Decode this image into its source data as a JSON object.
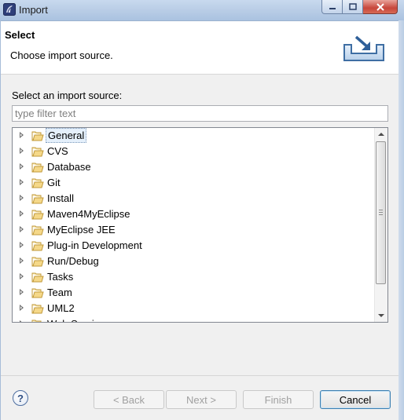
{
  "window": {
    "title": "Import"
  },
  "header": {
    "title": "Select",
    "description": "Choose import source."
  },
  "filter": {
    "label": "Select an import source:",
    "placeholder": "type filter text",
    "value": ""
  },
  "tree": {
    "selected_index": 0,
    "items": [
      {
        "label": "General"
      },
      {
        "label": "CVS"
      },
      {
        "label": "Database"
      },
      {
        "label": "Git"
      },
      {
        "label": "Install"
      },
      {
        "label": "Maven4MyEclipse"
      },
      {
        "label": "MyEclipse JEE"
      },
      {
        "label": "Plug-in Development"
      },
      {
        "label": "Run/Debug"
      },
      {
        "label": "Tasks"
      },
      {
        "label": "Team"
      },
      {
        "label": "UML2"
      },
      {
        "label": "Web Services"
      }
    ]
  },
  "footer": {
    "help_label": "?",
    "back_label": "< Back",
    "next_label": "Next >",
    "finish_label": "Finish",
    "cancel_label": "Cancel"
  },
  "icons": {
    "app": "eclipse-logo-icon",
    "folder": "open-folder-icon",
    "header": "import-tray-icon"
  },
  "colors": {
    "folder_fill": "#f5d889",
    "folder_stroke": "#c19a3b",
    "title_bar": "#b9cde6"
  }
}
